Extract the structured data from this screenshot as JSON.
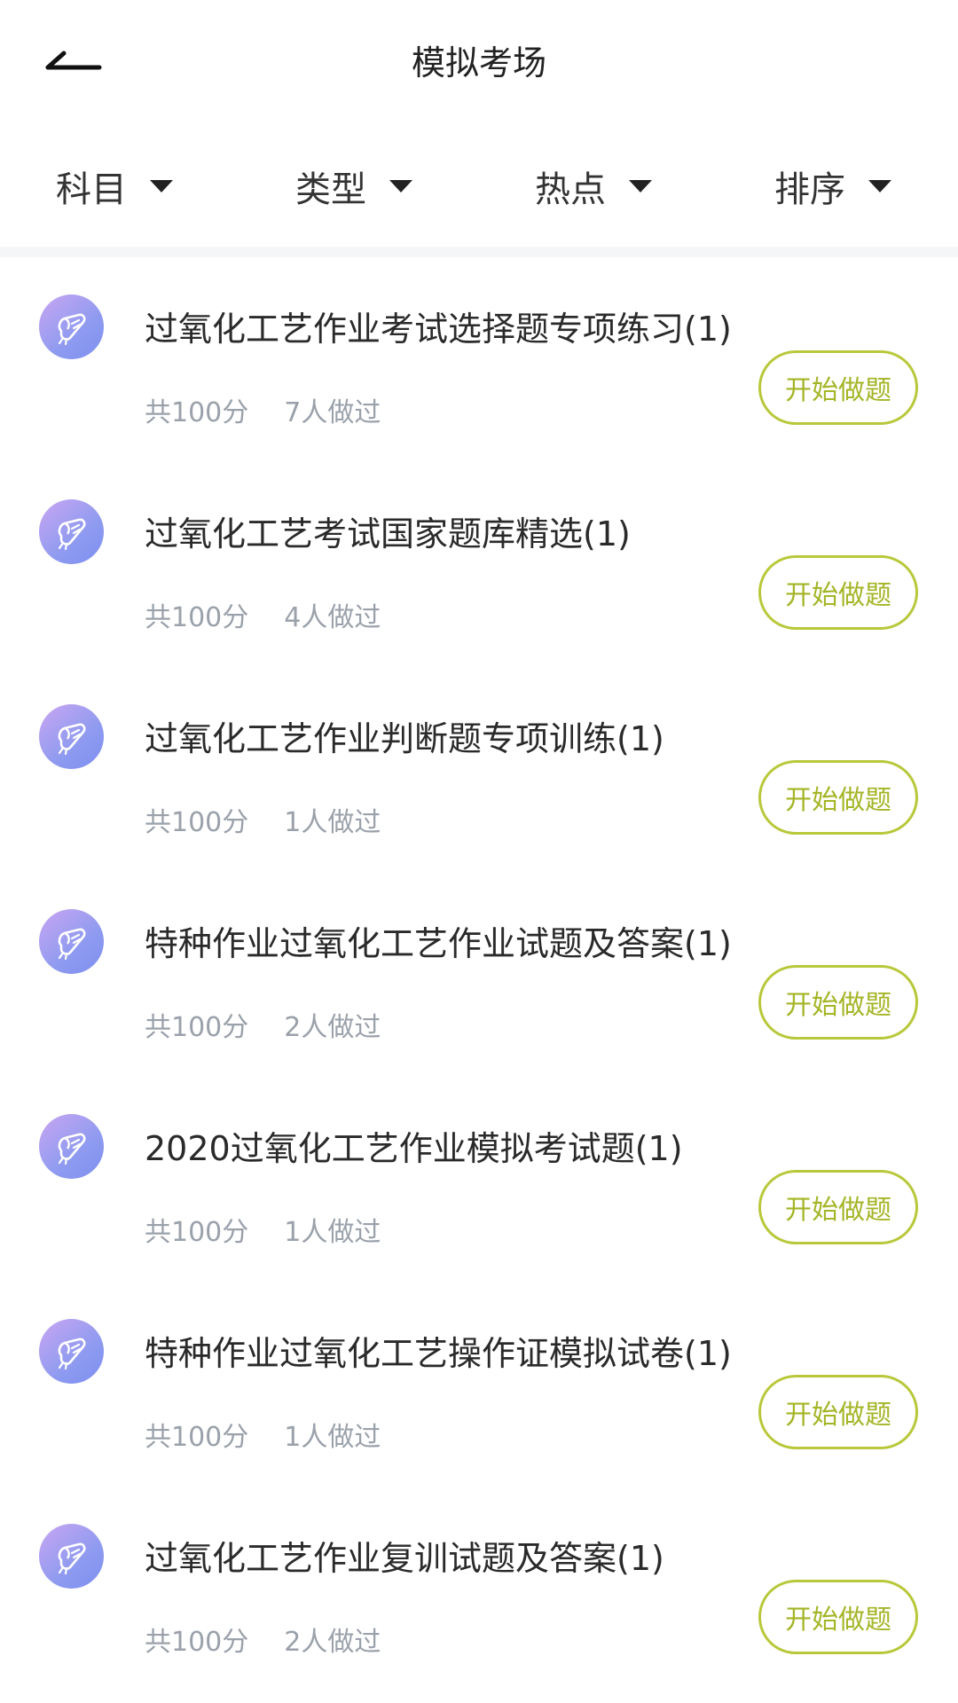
{
  "header": {
    "title": "模拟考场",
    "back_icon": "back-arrow-icon"
  },
  "filters": [
    {
      "label": "科目",
      "icon": "caret-down-icon"
    },
    {
      "label": "类型",
      "icon": "caret-down-icon"
    },
    {
      "label": "热点",
      "icon": "caret-down-icon"
    },
    {
      "label": "排序",
      "icon": "caret-down-icon"
    }
  ],
  "colors": {
    "accent": "#a4b526",
    "accent_border": "#b8c83a",
    "icon_gradient_start": "#c9a6f2",
    "icon_gradient_end": "#7d8ff0",
    "meta_text": "#9aa1aa"
  },
  "items": [
    {
      "title": "过氧化工艺作业考试选择题专项练习(1)",
      "score": "共100分",
      "count": "7人做过",
      "button": "开始做题",
      "icon": "scroll-certificate-icon"
    },
    {
      "title": "过氧化工艺考试国家题库精选(1)",
      "score": "共100分",
      "count": "4人做过",
      "button": "开始做题",
      "icon": "scroll-certificate-icon"
    },
    {
      "title": "过氧化工艺作业判断题专项训练(1)",
      "score": "共100分",
      "count": "1人做过",
      "button": "开始做题",
      "icon": "scroll-certificate-icon"
    },
    {
      "title": "特种作业过氧化工艺作业试题及答案(1)",
      "score": "共100分",
      "count": "2人做过",
      "button": "开始做题",
      "icon": "scroll-certificate-icon"
    },
    {
      "title": "2020过氧化工艺作业模拟考试题(1)",
      "score": "共100分",
      "count": "1人做过",
      "button": "开始做题",
      "icon": "scroll-certificate-icon"
    },
    {
      "title": "特种作业过氧化工艺操作证模拟试卷(1)",
      "score": "共100分",
      "count": "1人做过",
      "button": "开始做题",
      "icon": "scroll-certificate-icon"
    },
    {
      "title": "过氧化工艺作业复训试题及答案(1)",
      "score": "共100分",
      "count": "2人做过",
      "button": "开始做题",
      "icon": "scroll-certificate-icon"
    }
  ]
}
